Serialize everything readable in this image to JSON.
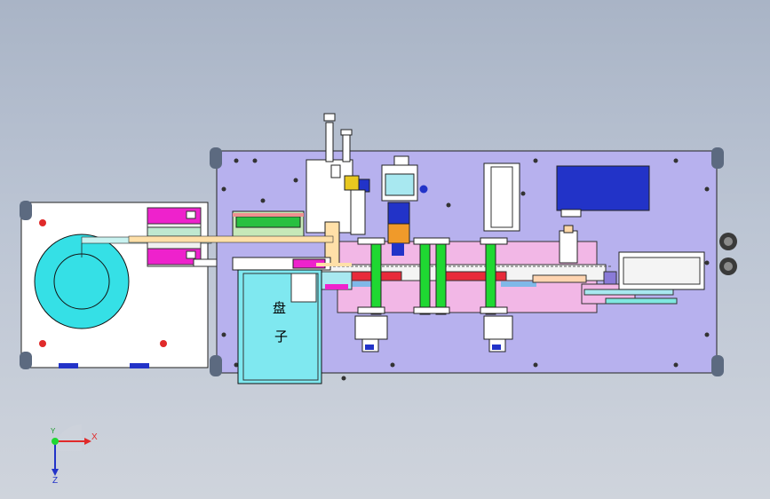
{
  "tray": {
    "char1": "盘",
    "char2": "子"
  },
  "triad": {
    "x_label": "X",
    "y_label": "Y",
    "z_label": "Z"
  },
  "colors": {
    "base_plate": "#b7b1ee",
    "rail_pink": "#f2b7e6",
    "tray_fill": "#7fe8f0",
    "feeder_body": "#ffffff",
    "reel": "#35e0e6",
    "cylinder_green": "#1fd832",
    "motor_blue": "#2233c8",
    "rail_red": "#e82a3a",
    "magenta": "#ee22cc"
  }
}
